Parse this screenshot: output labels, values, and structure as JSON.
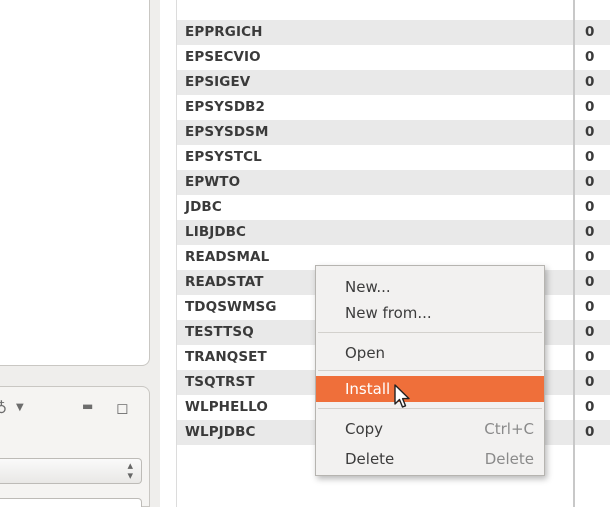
{
  "table": {
    "rows": [
      {
        "name": "EPPRGICH",
        "value": "0"
      },
      {
        "name": "EPSECVIO",
        "value": "0"
      },
      {
        "name": "EPSIGEV",
        "value": "0"
      },
      {
        "name": "EPSYSDB2",
        "value": "0"
      },
      {
        "name": "EPSYSDSM",
        "value": "0"
      },
      {
        "name": "EPSYSTCL",
        "value": "0"
      },
      {
        "name": "EPWTO",
        "value": "0"
      },
      {
        "name": "JDBC",
        "value": "0"
      },
      {
        "name": "LIBJDBC",
        "value": "0"
      },
      {
        "name": "READSMAL",
        "value": "0"
      },
      {
        "name": "READSTAT",
        "value": "0"
      },
      {
        "name": "TDQSWMSG",
        "value": "0"
      },
      {
        "name": "TESTTSQ",
        "value": "0"
      },
      {
        "name": "TRANQSET",
        "value": "0"
      },
      {
        "name": "TSQTRST",
        "value": "0"
      },
      {
        "name": "WLPHELLO",
        "value": "0"
      },
      {
        "name": "WLPJDBC",
        "value": "0"
      }
    ]
  },
  "context_menu": {
    "new": "New...",
    "new_from": "New from...",
    "open": "Open",
    "install": "Install",
    "copy": "Copy",
    "copy_shortcut": "Ctrl+C",
    "delete": "Delete",
    "delete_shortcut": "Delete",
    "highlight_color": "#ef6f3a"
  },
  "left_toolbar": {
    "icons": [
      "view-menu-icon",
      "dropdown-arrow-icon",
      "minimize-icon",
      "maximize-icon"
    ]
  }
}
